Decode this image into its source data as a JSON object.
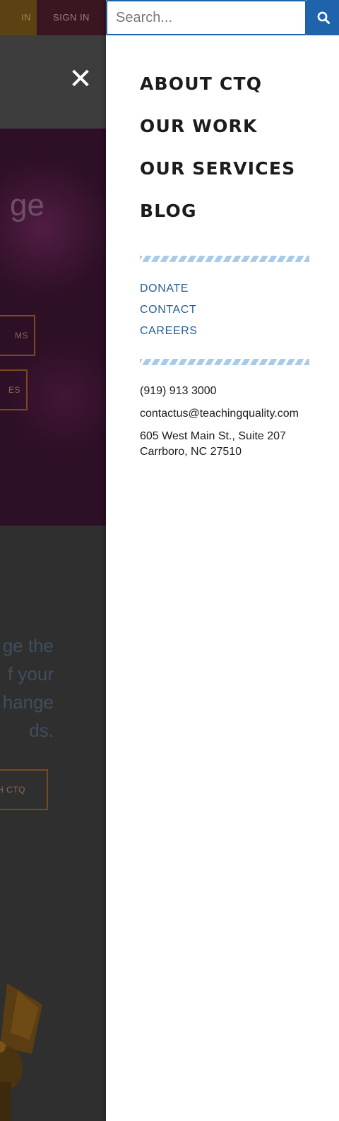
{
  "background_page": {
    "topbar": {
      "join_label": "IN",
      "signin_label": "SIGN IN"
    },
    "hero": {
      "headline_fragment": "ge",
      "buttons": [
        {
          "label": "MS"
        },
        {
          "label": "ES"
        }
      ]
    },
    "body_text_lines": [
      "ge the",
      "f your",
      "hange",
      "ds."
    ],
    "cta_label": "H CTQ",
    "colors": {
      "join_bg": "#5b4212",
      "signin_bg": "#3a1620",
      "hero_bg": "#2d0f26",
      "overlay": "#2e2e2e"
    }
  },
  "menu": {
    "close_icon": "close-icon",
    "search": {
      "placeholder": "Search...",
      "value": "",
      "button_icon": "search-icon"
    },
    "main_nav": [
      {
        "label": "ABOUT CTQ"
      },
      {
        "label": "OUR WORK"
      },
      {
        "label": "OUR SERVICES"
      },
      {
        "label": "BLOG"
      }
    ],
    "secondary_nav": [
      {
        "label": "DONATE"
      },
      {
        "label": "CONTACT"
      },
      {
        "label": "CAREERS"
      }
    ],
    "contact": {
      "phone": "(919) 913 3000",
      "email": "contactus@teachingquality.com",
      "address_line1": "605 West Main St., Suite 207",
      "address_line2": "Carrboro, NC 27510"
    },
    "colors": {
      "accent": "#1f63ad",
      "link": "#2a5f94",
      "divider": "#a9cbe8"
    }
  }
}
